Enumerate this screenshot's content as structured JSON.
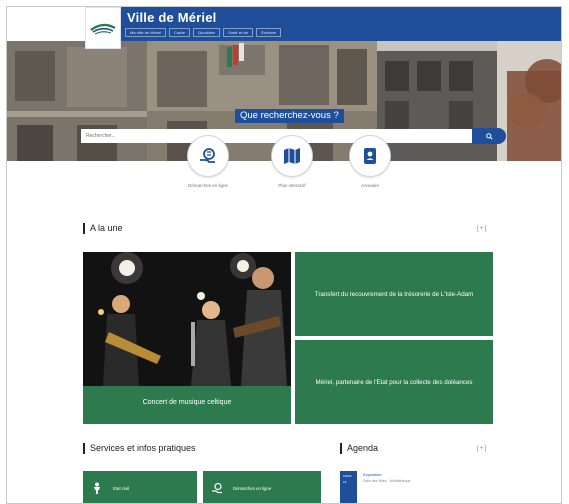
{
  "header": {
    "title": "Ville de Mériel",
    "nav": [
      "Ma ville de Mériel",
      "Cadre",
      "Quotidien",
      "Sortir et vie",
      "Enfance"
    ]
  },
  "hero": {
    "question": "Que recherchez-vous ?",
    "search_placeholder": "Rechercher..."
  },
  "quick_access": [
    {
      "icon": "hand-coins-icon",
      "label": "Démarches en ligne"
    },
    {
      "icon": "map-icon",
      "label": "Plan interactif"
    },
    {
      "icon": "contact-card-icon",
      "label": "Annuaire"
    }
  ],
  "sections": {
    "news_title": "A la une",
    "services_title": "Services et infos pratiques",
    "agenda_title": "Agenda",
    "more": "[+]"
  },
  "news": {
    "photo_caption": "Concert de musique celtique",
    "cards": [
      "Transfert du recouvrement de la trésorerie de L'Isle-Adam",
      "Mériel, partenaire de l'Etat pour la collecte des doléances"
    ]
  },
  "services": [
    {
      "icon": "person-icon",
      "label": "Etat civil"
    },
    {
      "icon": "hand-coins-icon",
      "label": "Démarches en ligne"
    }
  ],
  "agenda": {
    "date_lines": [
      "MARS",
      "15"
    ],
    "title": "Exposition",
    "subtitle": "Salle des fêtes - Médiathèque"
  },
  "colors": {
    "brand_blue": "#1f4e9b",
    "brand_green": "#2d7a4f"
  }
}
